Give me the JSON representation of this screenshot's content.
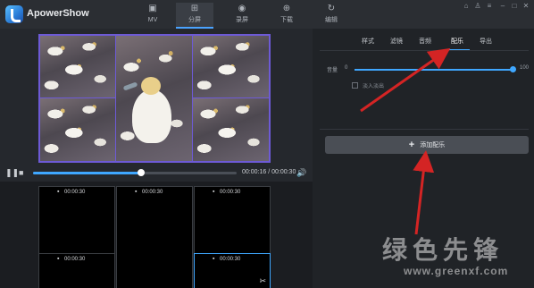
{
  "app": {
    "title": "ApowerShow"
  },
  "top_tabs": [
    {
      "id": "mv",
      "label": "MV",
      "icon": "film-icon",
      "active": false
    },
    {
      "id": "split",
      "label": "分屏",
      "icon": "split-screen-icon",
      "active": true
    },
    {
      "id": "record",
      "label": "录屏",
      "icon": "record-icon",
      "active": false
    },
    {
      "id": "download",
      "label": "下载",
      "icon": "download-icon",
      "active": false
    },
    {
      "id": "edit",
      "label": "编辑",
      "icon": "edit-icon",
      "active": false
    }
  ],
  "window_controls": [
    "cart-icon",
    "user-icon",
    "menu-icon",
    "minimize-icon",
    "maximize-icon",
    "close-icon"
  ],
  "player": {
    "current": "00:00:16",
    "total": "00:00:30",
    "progress": 0.53
  },
  "slots": [
    {
      "time": "00:00:30"
    },
    {
      "time": "00:00:30"
    },
    {
      "time": "00:00:30"
    },
    {
      "time": "00:00:30"
    },
    {
      "time": ""
    },
    {
      "time": "00:00:30"
    }
  ],
  "sub_tabs": [
    {
      "label": "样式",
      "active": false
    },
    {
      "label": "滤镜",
      "active": false
    },
    {
      "label": "音频",
      "active": false
    },
    {
      "label": "配乐",
      "active": true
    },
    {
      "label": "导出",
      "active": false
    }
  ],
  "music": {
    "volume_label": "音量",
    "volume_min": "0",
    "volume_max": "100",
    "volume_level": 1.0,
    "fade_label": "淡入淡出",
    "fade_checked": false,
    "add_button": "添加配乐"
  },
  "watermark": {
    "text": "绿色先锋",
    "url": "www.greenxf.com"
  },
  "colors": {
    "accent": "#3fa7ff",
    "frame": "#6d5ad6",
    "arrow": "#d42424"
  }
}
